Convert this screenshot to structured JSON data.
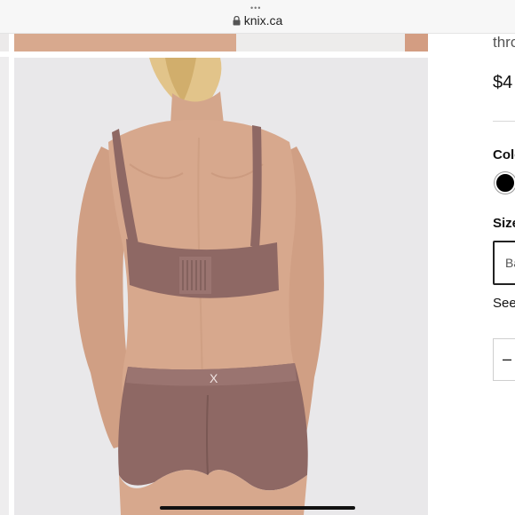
{
  "browser": {
    "menu_dots": "•••",
    "url": "knix.ca"
  },
  "product": {
    "name_fragment": "thro",
    "price_fragment": "$4",
    "color_label": "Colo",
    "selected_color": "#000000",
    "size_label": "Size",
    "size_select_value": "Ba",
    "size_guide_link": "See",
    "qty_minus": "–"
  },
  "hero_image": {
    "logo_mark": "X",
    "colors": {
      "garment": "#8e6864",
      "background": "#e9e8ea",
      "skin": "#d7a88d"
    }
  }
}
